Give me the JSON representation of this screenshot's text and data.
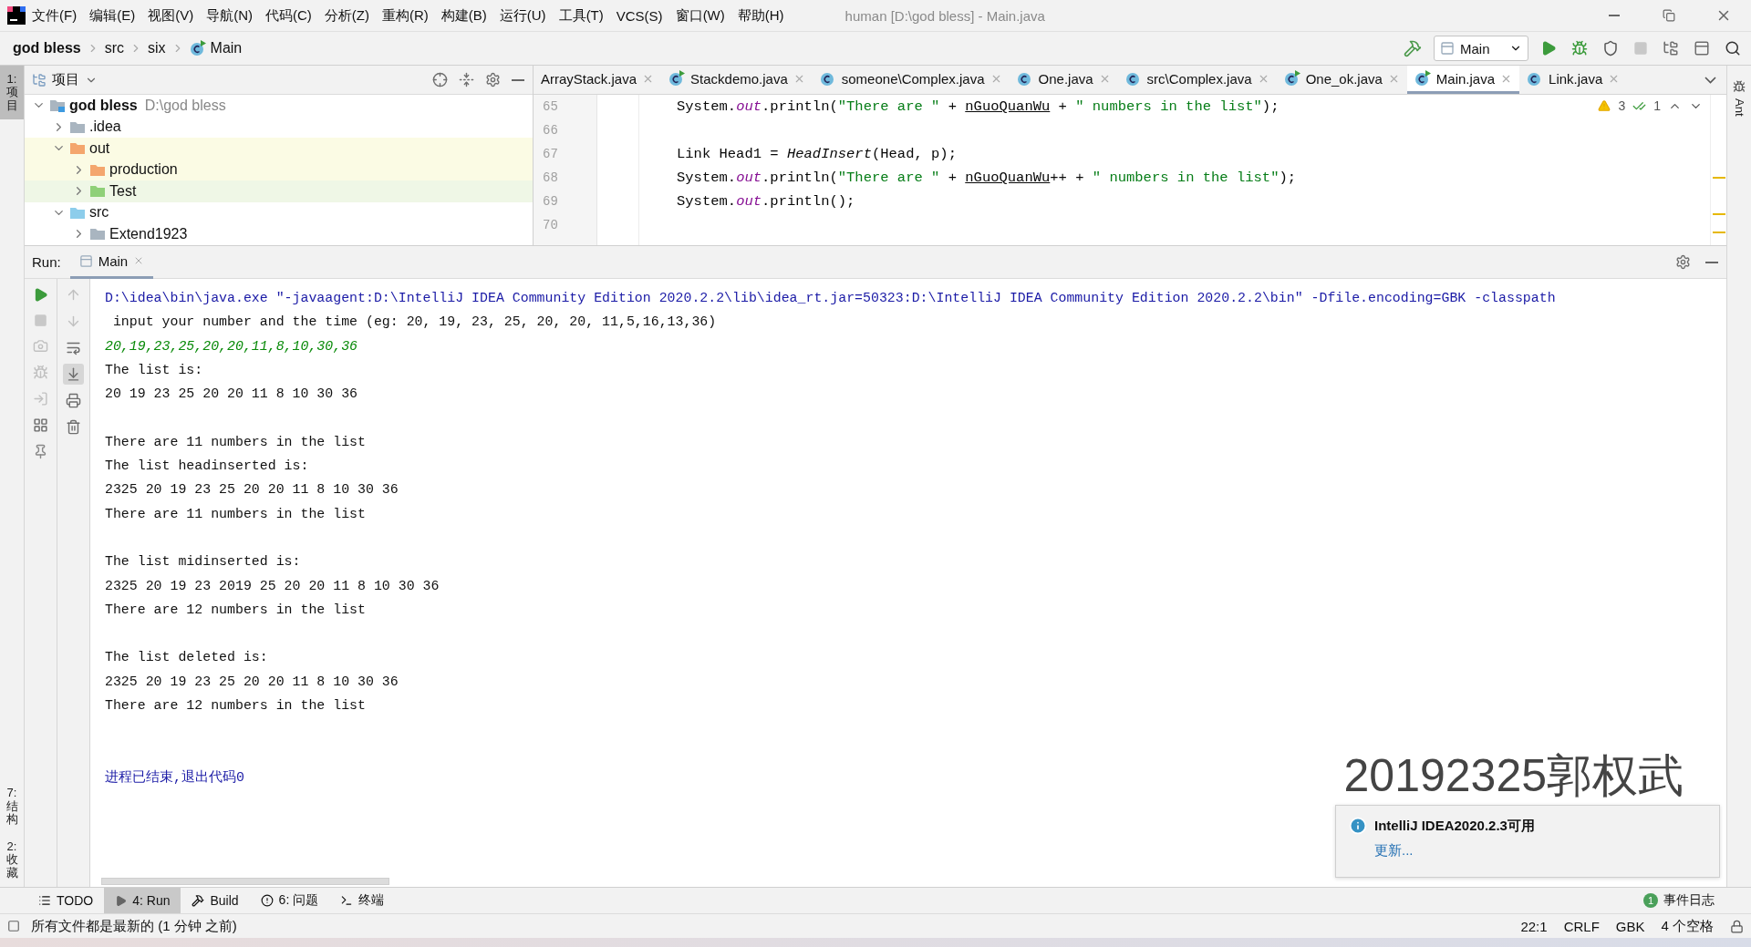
{
  "window": {
    "title": "human [D:\\god bless] - Main.java"
  },
  "menu": [
    "文件(F)",
    "编辑(E)",
    "视图(V)",
    "导航(N)",
    "代码(C)",
    "分析(Z)",
    "重构(R)",
    "构建(B)",
    "运行(U)",
    "工具(T)",
    "VCS(S)",
    "窗口(W)",
    "帮助(H)"
  ],
  "breadcrumb": [
    {
      "label": "god bless",
      "kind": "project"
    },
    {
      "label": "src",
      "kind": "folder"
    },
    {
      "label": "six",
      "kind": "folder"
    },
    {
      "label": "Main",
      "kind": "class"
    }
  ],
  "toolbar": {
    "run_config": "Main",
    "stop": {
      "disabled": true
    }
  },
  "left_stripe": {
    "top": [
      {
        "label": "1: 项目",
        "selected": true
      }
    ],
    "bottom": [
      {
        "label": "7: 结构",
        "selected": false
      },
      {
        "label": "2: 收藏",
        "selected": false
      }
    ]
  },
  "right_stripe": [
    {
      "label": "Ant"
    }
  ],
  "project": {
    "title": "项目",
    "tree": [
      {
        "label": "god bless",
        "path": "D:\\god bless",
        "kind": "module",
        "expanded": true,
        "children": [
          {
            "label": ".idea",
            "kind": "plain",
            "expanded": false
          },
          {
            "label": "out",
            "kind": "excluded",
            "expanded": true,
            "children": [
              {
                "label": "production",
                "kind": "excluded",
                "expanded": false
              },
              {
                "label": "Test",
                "kind": "test",
                "expanded": false
              }
            ]
          },
          {
            "label": "src",
            "kind": "source",
            "expanded": true,
            "children": [
              {
                "label": "Extend1923",
                "kind": "plain",
                "expanded": false
              }
            ]
          }
        ]
      }
    ]
  },
  "editor": {
    "tabs": [
      {
        "label": "ArrayStack.java",
        "kind": "plain",
        "selected": false
      },
      {
        "label": "Stackdemo.java",
        "kind": "runnable",
        "selected": false
      },
      {
        "label": "someone\\Complex.java",
        "kind": "class",
        "selected": false
      },
      {
        "label": "One.java",
        "kind": "class",
        "selected": false
      },
      {
        "label": "src\\Complex.java",
        "kind": "class",
        "selected": false
      },
      {
        "label": "One_ok.java",
        "kind": "runnable",
        "selected": false
      },
      {
        "label": "Main.java",
        "kind": "runnable",
        "selected": true
      },
      {
        "label": "Link.java",
        "kind": "class",
        "selected": false
      }
    ],
    "inspections": {
      "warnings": "3",
      "typos": "1"
    },
    "lines": [
      {
        "number": "65",
        "tokens": [
          {
            "text": "System.",
            "kind": "plain"
          },
          {
            "text": "out",
            "kind": "static"
          },
          {
            "text": ".println(",
            "kind": "plain"
          },
          {
            "text": "\"There are \"",
            "kind": "string"
          },
          {
            "text": " + ",
            "kind": "plain"
          },
          {
            "text": "nGuoQuanWu",
            "kind": "underlined"
          },
          {
            "text": " + ",
            "kind": "plain"
          },
          {
            "text": "\" numbers in the list\"",
            "kind": "string"
          },
          {
            "text": ");",
            "kind": "plain"
          }
        ]
      },
      {
        "number": "66"
      },
      {
        "number": "67",
        "tokens": [
          {
            "text": "Link Head1 = ",
            "kind": "plain"
          },
          {
            "text": "HeadInsert",
            "kind": "italic"
          },
          {
            "text": "(Head, p);",
            "kind": "plain"
          }
        ]
      },
      {
        "number": "68",
        "tokens": [
          {
            "text": "System.",
            "kind": "plain"
          },
          {
            "text": "out",
            "kind": "static"
          },
          {
            "text": ".println(",
            "kind": "plain"
          },
          {
            "text": "\"There are \"",
            "kind": "string"
          },
          {
            "text": " + ",
            "kind": "plain"
          },
          {
            "text": "nGuoQuanWu",
            "kind": "underlined"
          },
          {
            "text": "++ + ",
            "kind": "plain"
          },
          {
            "text": "\" numbers in the list\"",
            "kind": "string"
          },
          {
            "text": ");",
            "kind": "plain"
          }
        ]
      },
      {
        "number": "69",
        "tokens": [
          {
            "text": "System.",
            "kind": "plain"
          },
          {
            "text": "out",
            "kind": "static"
          },
          {
            "text": ".println();",
            "kind": "plain"
          }
        ]
      },
      {
        "number": "70"
      }
    ]
  },
  "run": {
    "label": "Run:",
    "tabs": [
      {
        "label": "Main",
        "selected": true
      }
    ],
    "scroll_to_end": {
      "on": true
    },
    "stop": {
      "disabled": true
    },
    "console": [
      {
        "kind": "command",
        "text": "D:\\idea\\bin\\java.exe \"-javaagent:D:\\IntelliJ IDEA Community Edition 2020.2.2\\lib\\idea_rt.jar=50323:D:\\IntelliJ IDEA Community Edition 2020.2.2\\bin\" -Dfile.encoding=GBK -classpath"
      },
      {
        "kind": "output",
        "text": " input your number and the time (eg: 20, 19, 23, 25, 20, 20, 11,5,16,13,36)"
      },
      {
        "kind": "input",
        "text": "20,19,23,25,20,20,11,8,10,30,36"
      },
      {
        "kind": "output",
        "text": "The list is:"
      },
      {
        "kind": "output",
        "text": "20 19 23 25 20 20 11 8 10 30 36"
      },
      {
        "kind": "blank"
      },
      {
        "kind": "output",
        "text": "There are 11 numbers in the list"
      },
      {
        "kind": "output",
        "text": "The list headinserted is:"
      },
      {
        "kind": "output",
        "text": "2325 20 19 23 25 20 20 11 8 10 30 36"
      },
      {
        "kind": "output",
        "text": "There are 11 numbers in the list"
      },
      {
        "kind": "blank"
      },
      {
        "kind": "output",
        "text": "The list midinserted is:"
      },
      {
        "kind": "output",
        "text": "2325 20 19 23 2019 25 20 20 11 8 10 30 36"
      },
      {
        "kind": "output",
        "text": "There are 12 numbers in the list"
      },
      {
        "kind": "blank"
      },
      {
        "kind": "output",
        "text": "The list deleted is:"
      },
      {
        "kind": "output",
        "text": "2325 20 19 23 25 20 20 11 8 10 30 36"
      },
      {
        "kind": "output",
        "text": "There are 12 numbers in the list"
      },
      {
        "kind": "blank"
      },
      {
        "kind": "blank"
      },
      {
        "kind": "exit",
        "text": "进程已结束,退出代码0"
      }
    ]
  },
  "overlay_label": "20192325郭权武",
  "notification": {
    "title": "IntelliJ IDEA2020.2.3可用",
    "link": "更新..."
  },
  "tool_tabs": [
    {
      "label": "TODO",
      "kind": "list",
      "selected": false
    },
    {
      "label": "4: Run",
      "kind": "run",
      "selected": true
    },
    {
      "label": "Build",
      "kind": "build",
      "selected": false
    },
    {
      "label": "6: 问题",
      "kind": "problems",
      "selected": false
    },
    {
      "label": "终端",
      "kind": "terminal",
      "selected": false
    }
  ],
  "event_log": {
    "count": "1",
    "label": "事件日志"
  },
  "status_bar": {
    "message": "所有文件都是最新的 (1 分钟 之前)",
    "position": "22:1",
    "line_separator": "CRLF",
    "encoding": "GBK",
    "indent": "4 个空格"
  }
}
